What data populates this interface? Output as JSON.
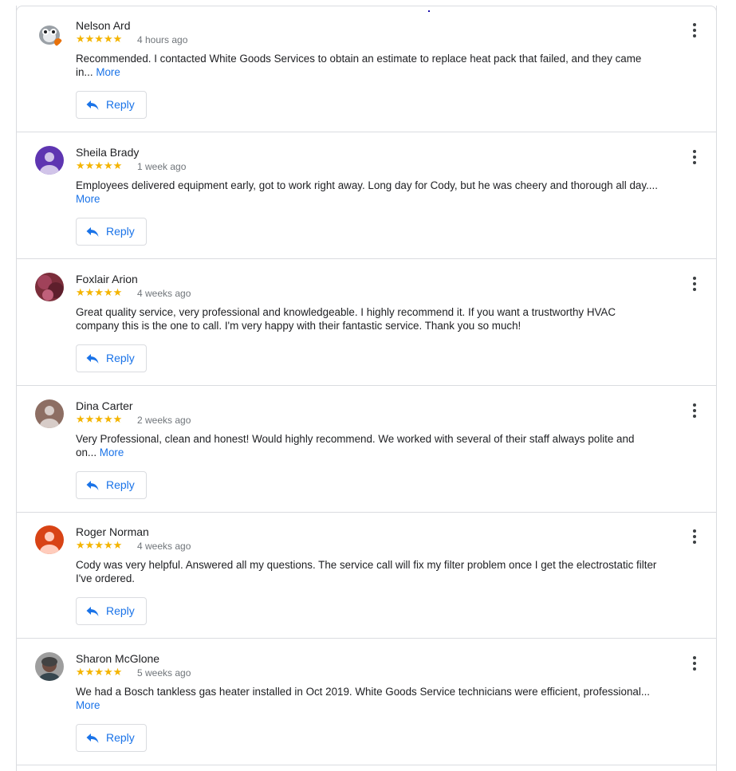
{
  "reviews": [
    {
      "name": "Nelson Ard",
      "stars": "★★★★★",
      "rating": 5,
      "time": "4 hours ago",
      "text": "Recommended. I contacted White Goods Services to obtain an estimate to replace heat pack that failed, and they came in...",
      "more": "More",
      "reply": "Reply",
      "avatar": "cartoon-animal"
    },
    {
      "name": "Sheila Brady",
      "stars": "★★★★★",
      "rating": 5,
      "time": "1 week ago",
      "text": "Employees delivered equipment early, got to work right away. Long day for Cody, but he was cheery and thorough all day....",
      "more": "More",
      "reply": "Reply",
      "avatar": "purple-silhouette"
    },
    {
      "name": "Foxlair Arion",
      "stars": "★★★★★",
      "rating": 5,
      "time": "4 weeks ago",
      "text": "Great quality service, very professional and knowledgeable. I highly recommend it. If you want a trustworthy HVAC company this is the one to call. I'm very happy with their fantastic service. Thank you so much!",
      "more": "",
      "reply": "Reply",
      "avatar": "photo"
    },
    {
      "name": "Dina Carter",
      "stars": "★★★★★",
      "rating": 5,
      "time": "2 weeks ago",
      "text": "Very Professional, clean and honest! Would highly recommend. We worked with several of their staff always polite and on...",
      "more": "More",
      "reply": "Reply",
      "avatar": "brown-silhouette"
    },
    {
      "name": "Roger Norman",
      "stars": "★★★★★",
      "rating": 5,
      "time": "4 weeks ago",
      "text": "Cody was very helpful. Answered all my questions. The service call will fix my filter problem once I get the electrostatic filter I've ordered.",
      "more": "",
      "reply": "Reply",
      "avatar": "orange-silhouette"
    },
    {
      "name": "Sharon McGlone",
      "stars": "★★★★★",
      "rating": 5,
      "time": "5 weeks ago",
      "text": "We had a Bosch tankless gas heater installed in Oct 2019. White Goods Service technicians were efficient, professional...",
      "more": "More",
      "reply": "Reply",
      "avatar": "photo"
    }
  ],
  "colors": {
    "accent": "#1a73e8",
    "star": "#f4b400",
    "border": "#dadce0"
  }
}
